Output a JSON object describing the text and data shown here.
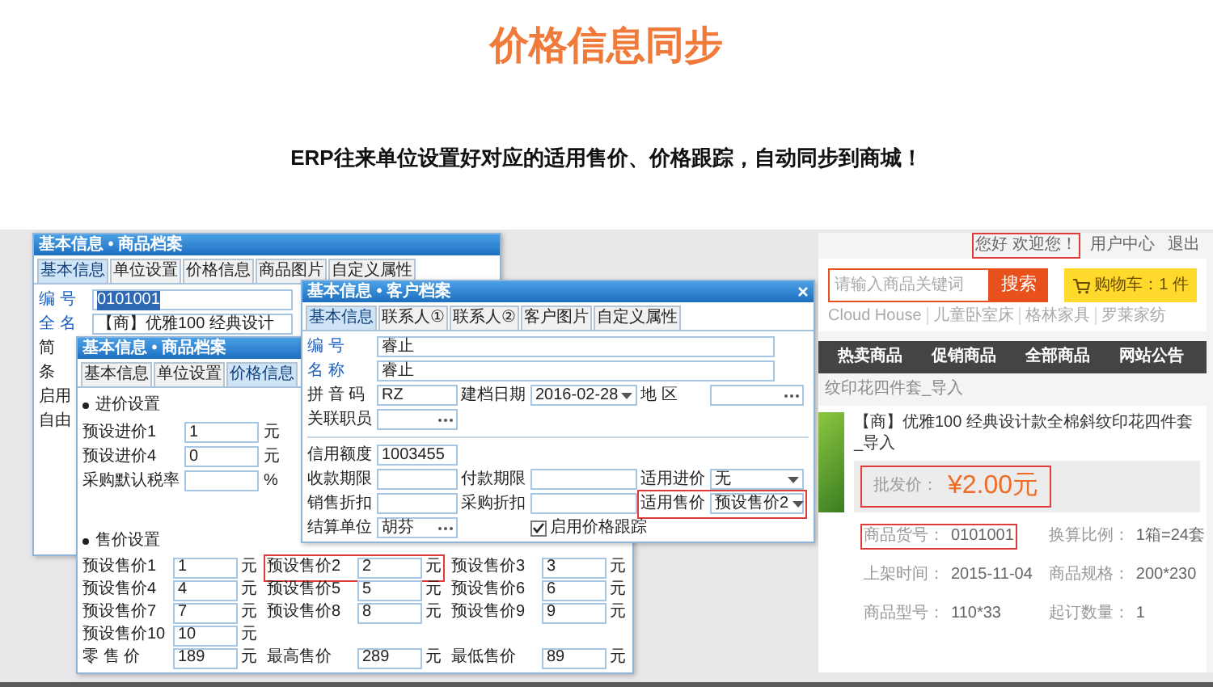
{
  "page_title": "价格信息同步",
  "subtitle": "ERP往来单位设置好对应的适用售价、价格跟踪，自动同步到商城！",
  "product_window": {
    "title": "基本信息 • 商品档案",
    "tabs": [
      {
        "label": "基本信息",
        "selected": true
      },
      {
        "label": "单位设置",
        "selected": false
      },
      {
        "label": "价格信息",
        "selected": false
      },
      {
        "label": "商品图片",
        "selected": false
      },
      {
        "label": "自定义属性",
        "selected": false
      }
    ],
    "fields": [
      {
        "label": "编 号",
        "required": true,
        "value": "0101001",
        "value_highlighted": true
      },
      {
        "label": "全 名",
        "required": true,
        "value": "【商】优雅100 经典设计",
        "value_highlighted": false
      },
      {
        "label": "简"
      },
      {
        "label": "条"
      },
      {
        "label": "启用"
      },
      {
        "label": "自由"
      }
    ]
  },
  "price_window": {
    "title": "基本信息 • 商品档案",
    "tabs": [
      {
        "label": "基本信息",
        "selected": false
      },
      {
        "label": "单位设置",
        "selected": false
      },
      {
        "label": "价格信息",
        "selected": true
      }
    ],
    "purchase_section": {
      "title": "进价设置",
      "rows": [
        {
          "label": "预设进价1",
          "value": "1",
          "unit": "元"
        },
        {
          "label": "预设进价4",
          "value": "0",
          "unit": "元"
        },
        {
          "label": "采购默认税率",
          "unit": "%"
        }
      ]
    },
    "sale_section": {
      "title": "售价设置",
      "rows": [
        [
          {
            "label": "预设售价1",
            "value": "1",
            "unit": "元"
          },
          {
            "label": "预设售价2",
            "value": "2",
            "unit": "元",
            "highlighted": true
          },
          {
            "label": "预设售价3",
            "value": "3",
            "unit": "元"
          }
        ],
        [
          {
            "label": "预设售价4",
            "value": "4",
            "unit": "元"
          },
          {
            "label": "预设售价5",
            "value": "5",
            "unit": "元"
          },
          {
            "label": "预设售价6",
            "value": "6",
            "unit": "元"
          }
        ],
        [
          {
            "label": "预设售价7",
            "value": "7",
            "unit": "元"
          },
          {
            "label": "预设售价8",
            "value": "8",
            "unit": "元"
          },
          {
            "label": "预设售价9",
            "value": "9",
            "unit": "元"
          }
        ],
        [
          {
            "label": "预设售价10",
            "value": "10",
            "unit": "元"
          }
        ],
        [
          {
            "label": "零 售 价",
            "value": "189",
            "unit": "元"
          },
          {
            "label": "最高售价",
            "value": "289",
            "unit": "元"
          },
          {
            "label": "最低售价",
            "value": "89",
            "unit": "元"
          }
        ]
      ]
    }
  },
  "customer_window": {
    "title": "基本信息 • 客户档案",
    "tabs": [
      {
        "label": "基本信息",
        "selected": true
      },
      {
        "label": "联系人①",
        "selected": false
      },
      {
        "label": "联系人②",
        "selected": false
      },
      {
        "label": "客户图片",
        "selected": false
      },
      {
        "label": "自定义属性",
        "selected": false
      }
    ],
    "groups": [
      [
        [
          {
            "kind": "text",
            "label": "编 号",
            "value": "睿止",
            "required": true,
            "wide": true
          }
        ],
        [
          {
            "kind": "text",
            "label": "名 称",
            "value": "睿止",
            "required": true,
            "wide": true
          }
        ],
        [
          {
            "kind": "text",
            "label": "拼 音 码",
            "value": "RZ"
          },
          {
            "kind": "select",
            "label": "建档日期",
            "value": "2016-02-28"
          },
          {
            "kind": "lookup",
            "label": "地 区"
          }
        ],
        [
          {
            "kind": "lookup",
            "label": "关联职员"
          }
        ]
      ],
      [
        [
          {
            "kind": "text",
            "label": "信用额度",
            "value": "1003455"
          }
        ],
        [
          {
            "kind": "text",
            "label": "收款期限"
          },
          {
            "kind": "text",
            "label": "付款期限"
          },
          {
            "kind": "select",
            "label": "适用进价",
            "value": "无"
          }
        ],
        [
          {
            "kind": "text",
            "label": "销售折扣"
          },
          {
            "kind": "text",
            "label": "采购折扣"
          },
          {
            "kind": "select",
            "label": "适用售价",
            "value": "预设售价2",
            "highlighted": true
          }
        ],
        [
          {
            "kind": "lookup",
            "label": "结算单位",
            "value": "胡芬"
          },
          {
            "kind": "check",
            "label": "启用价格跟踪",
            "checked": true
          }
        ]
      ]
    ]
  },
  "shop": {
    "top_links": [
      {
        "text": "您好 欢迎您！",
        "highlighted": true
      },
      {
        "text": "用户中心"
      },
      {
        "text": "退出"
      }
    ],
    "search_placeholder": "请输入商品关键词",
    "search_button": "搜索",
    "cart": "购物车：1 件",
    "hot_words": [
      "Cloud House",
      "儿童卧室床",
      "格林家具",
      "罗莱家纺"
    ],
    "nav": [
      "热卖商品",
      "促销商品",
      "全部商品",
      "网站公告"
    ],
    "breadcrumb": "纹印花四件套_导入",
    "product_title": "【商】优雅100 经典设计款全棉斜纹印花四件套_导入",
    "price_label": "批发价：",
    "price": "¥2.00元",
    "price_highlighted": true,
    "details": [
      {
        "label": "商品货号：",
        "value": "0101001",
        "highlighted": true
      },
      {
        "label": "换算比例：",
        "value": "1箱=24套"
      },
      {
        "label": "上架时间：",
        "value": "2015-11-04"
      },
      {
        "label": "商品规格：",
        "value": "200*230"
      },
      {
        "label": "商品型号：",
        "value": "110*33"
      },
      {
        "label": "起订数量：",
        "value": "1"
      }
    ]
  }
}
